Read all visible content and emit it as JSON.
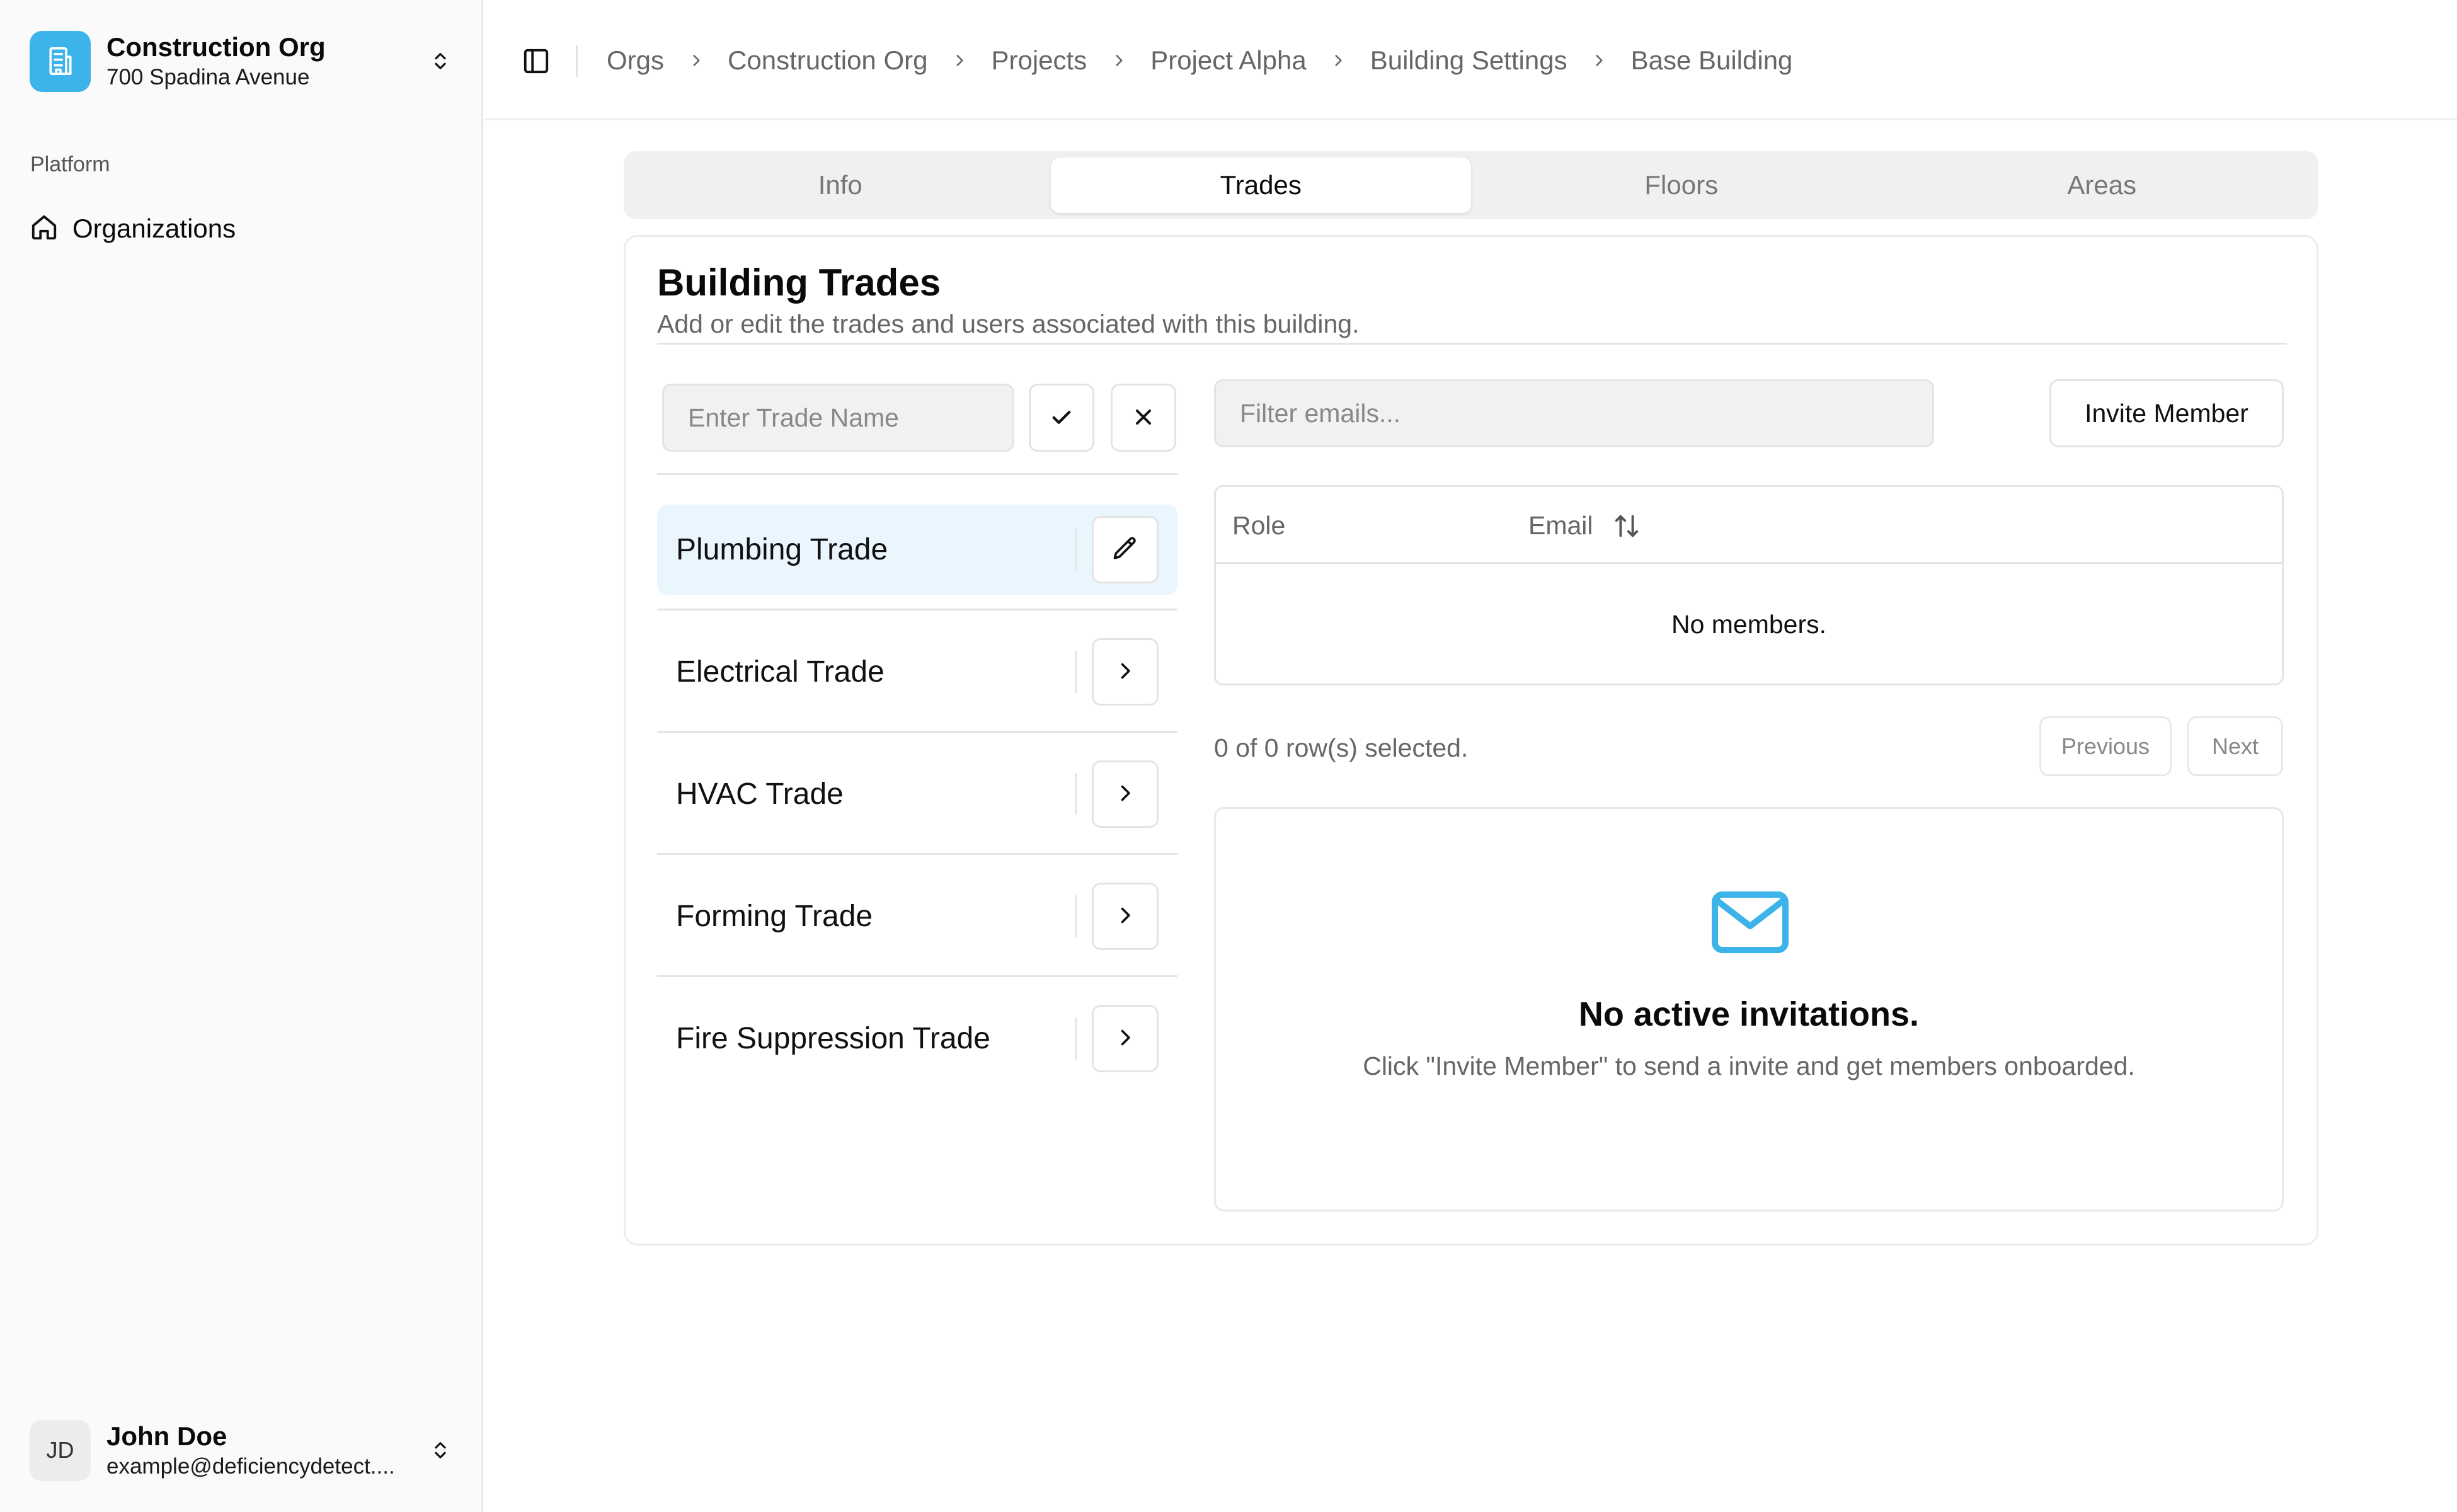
{
  "org": {
    "name": "Construction Org",
    "address": "700 Spadina Avenue",
    "accent": "#3cb4ea"
  },
  "sidebar": {
    "group_label": "Platform",
    "items": [
      {
        "label": "Organizations",
        "icon": "home-icon"
      }
    ]
  },
  "user": {
    "initials": "JD",
    "name": "John Doe",
    "email": "example@deficiencydetect...."
  },
  "breadcrumb": [
    "Orgs",
    "Construction Org",
    "Projects",
    "Project Alpha",
    "Building Settings",
    "Base Building"
  ],
  "tabs": [
    {
      "label": "Info",
      "active": false
    },
    {
      "label": "Trades",
      "active": true
    },
    {
      "label": "Floors",
      "active": false
    },
    {
      "label": "Areas",
      "active": false
    }
  ],
  "card": {
    "title": "Building Trades",
    "description": "Add or edit the trades and users associated with this building."
  },
  "trade_input": {
    "placeholder": "Enter Trade Name",
    "value": ""
  },
  "trades": [
    {
      "label": "Plumbing Trade",
      "active": true,
      "action_icon": "pencil-icon"
    },
    {
      "label": "Electrical Trade",
      "active": false,
      "action_icon": "chevron-right-icon"
    },
    {
      "label": "HVAC Trade",
      "active": false,
      "action_icon": "chevron-right-icon"
    },
    {
      "label": "Forming Trade",
      "active": false,
      "action_icon": "chevron-right-icon"
    },
    {
      "label": "Fire Suppression Trade",
      "active": false,
      "action_icon": "chevron-right-icon"
    }
  ],
  "members": {
    "filter_placeholder": "Filter emails...",
    "invite_label": "Invite Member",
    "columns": [
      "Role",
      "Email"
    ],
    "empty_text": "No members.",
    "selected_text": "0 of 0 row(s) selected.",
    "prev_label": "Previous",
    "next_label": "Next"
  },
  "invitations": {
    "title": "No active invitations.",
    "description": "Click \"Invite Member\" to send a invite and get members onboarded.",
    "icon": "mail-icon",
    "icon_color": "#3cb4ea"
  }
}
